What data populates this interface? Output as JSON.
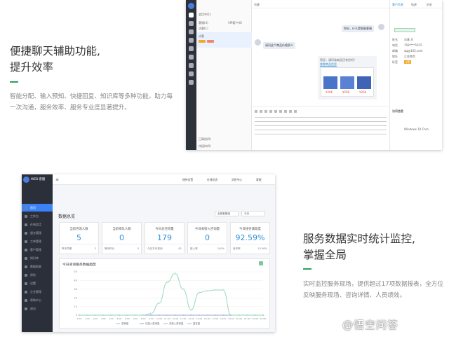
{
  "section1": {
    "title_line1": "便捷聊天辅助功能,",
    "title_line2": "提升效率",
    "desc": "智能分配、输入预知、快捷回复、知识库等多种功能，助力每一次沟通，服务效率、服务专业度显著提升。"
  },
  "section2": {
    "title_line1": "服务数据实时统计监控,",
    "title_line2": "掌握全局",
    "desc": "实时监控服务现场，提供超过17项数据报表，全方位反映服务现场、咨询详情、人员绩效。"
  },
  "chat": {
    "list_header": "会话中(1)",
    "list_stats": [
      "客服(3)",
      "VIP客户(0)",
      "访客(1)"
    ],
    "active_visitor": "访客",
    "active_tag": "VIP",
    "visitor_msg": "你好，什么是智能客服",
    "agent_msg": "请问这个商品价格多少",
    "link_text": "查看商品信息",
    "product_title": "您好，请问该商品还有货吗？",
    "prices": [
      "¥266",
      "¥266",
      "¥266"
    ],
    "footer_groups": [
      "已离线(0)",
      "待接待(0)"
    ],
    "tabs": [
      "客户信息",
      "轨迹",
      "历史"
    ],
    "fields": [
      {
        "label": "姓名",
        "value": "访客_8"
      },
      {
        "label": "电话",
        "value": "158****1615"
      },
      {
        "label": "邮箱",
        "value": "qq@163.com"
      },
      {
        "label": "地址",
        "value": "江苏南京"
      },
      {
        "label": "标签",
        "value": "VIP"
      }
    ],
    "source_title": "访问信息",
    "os": "Windows 10 Chro"
  },
  "dashboard": {
    "brand": "WEB 客服",
    "menu": [
      "首页",
      "工作台",
      "在线会话",
      "留言管理",
      "工单管理",
      "客户管理",
      "知识库",
      "数据报表",
      "质检",
      "设置",
      "企业管理",
      "帮助中心",
      "退出"
    ],
    "toolbar": [
      "接待设置",
      "在线状态",
      "消息中心",
      "客服"
    ],
    "title": "数据总览",
    "filters": [
      "全部客服组",
      "今天"
    ],
    "cards": [
      {
        "label": "当前咨询人数",
        "value": "5",
        "foot": [
          "昨天同期",
          "2"
        ]
      },
      {
        "label": "当前排队人数",
        "value": "0",
        "foot": [
          "等待时长",
          "0"
        ]
      },
      {
        "label": "今日总咨询量",
        "value": "179",
        "foot": [
          "今日平均咨询",
          "81"
        ]
      },
      {
        "label": "今日未接入咨询量",
        "value": "0",
        "foot": [
          "接入率",
          "100%"
        ]
      },
      {
        "label": "今日接待满意度",
        "value": "92.59%",
        "foot": [
          "参评率",
          "15.36%"
        ]
      }
    ],
    "chart_title": "今日咨询服务数据趋势"
  },
  "chart_data": {
    "type": "line",
    "title": "今日咨询服务数据趋势",
    "x": [
      "0:00",
      "1:00",
      "2:00",
      "3:00",
      "4:00",
      "5:00",
      "6:00",
      "7:00",
      "8:00",
      "9:00",
      "10:00",
      "11:00",
      "12:00",
      "13:00",
      "14:00",
      "15:00",
      "16:00",
      "17:00",
      "18:00",
      "19:00",
      "20:00",
      "21:00",
      "22:00",
      "23:00"
    ],
    "ylim": [
      0,
      50
    ],
    "yticks": [
      0,
      10,
      20,
      30,
      40,
      50
    ],
    "series": [
      {
        "name": "咨询量",
        "color": "#8ed4b0",
        "values": [
          0,
          0,
          0,
          0,
          0,
          0,
          0,
          0,
          0,
          2,
          14,
          38,
          48,
          30,
          6,
          26,
          28,
          29,
          29,
          0,
          0,
          0,
          0,
          0
        ]
      },
      {
        "name": "已接入咨询量",
        "color": "#9aa6d8",
        "values": [
          0,
          0,
          0,
          0,
          0,
          0,
          0,
          0,
          0,
          0,
          0,
          0,
          0,
          0,
          0,
          0,
          0,
          0,
          0,
          0,
          0,
          0,
          0,
          0
        ]
      },
      {
        "name": "未接入咨询量",
        "color": "#c7a7d8",
        "values": [
          0,
          0,
          0,
          0,
          0,
          0,
          0,
          0,
          0,
          0,
          0,
          0,
          0,
          0,
          0,
          0,
          0,
          0,
          0,
          0,
          0,
          0,
          0,
          0
        ]
      },
      {
        "name": "留言量",
        "color": "#a7b4e0",
        "values": [
          0,
          0,
          0,
          0,
          0,
          0,
          0,
          0,
          0,
          0,
          0,
          0,
          0,
          0,
          0,
          0,
          0,
          0,
          0,
          0,
          0,
          0,
          0,
          0
        ]
      }
    ],
    "grid": true,
    "legend": "bottom"
  },
  "watermark": "@悟空问答"
}
